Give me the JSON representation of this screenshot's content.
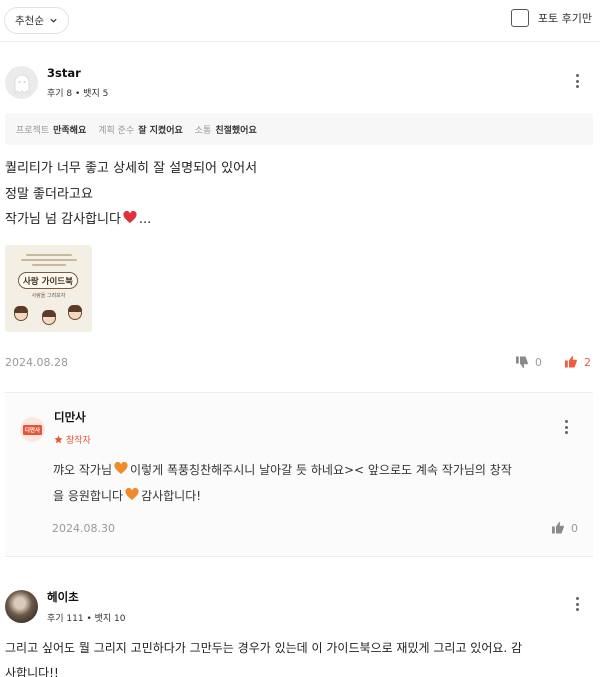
{
  "toolbar": {
    "sort_label": "추천순",
    "photo_filter_label": "포토 후기만"
  },
  "reviews": [
    {
      "author": "3star",
      "stats": "후기 8 • 뱃지 5",
      "ratings": [
        {
          "label": "프로젝트",
          "value": "만족해요"
        },
        {
          "label": "계획 준수",
          "value": "잘 지켰어요"
        },
        {
          "label": "소통",
          "value": "친절했어요"
        }
      ],
      "body": {
        "line1": "퀄리티가 너무 좋고 상세히 잘 설명되어 있어서",
        "line2": "정말 좋더라고요",
        "line3_before": "작가님 넘 감사합니다",
        "line3_after": "..."
      },
      "photo": {
        "title": "사랑 가이드북",
        "caption": "사랑을 그려보자"
      },
      "date": "2024.08.28",
      "dislikes": "0",
      "likes": "2",
      "reply": {
        "author": "디만사",
        "logo_text": "디만사",
        "badge": "창작자",
        "line1_a": "꺄오 작가님",
        "line1_b": "이렇게 폭풍칭찬해주시니 날아갈 듯 하네요>< 앞으로도 계속 작가님의 창작",
        "line2_a": "을 응원합니다",
        "line2_b": "감사합니다!",
        "date": "2024.08.30",
        "likes": "0"
      }
    },
    {
      "author": "헤이초",
      "stats": "후기 111 • 뱃지 10",
      "body": {
        "line1": "그리고 싶어도 뭘 그리지 고민하다가 그만두는 경우가 있는데 이 가이드북으로 재밌게 그리고 있어요. 감",
        "line2": "사합니다!!"
      }
    }
  ],
  "colors": {
    "accent": "#f25c3b",
    "creator": "#e8543a",
    "muted": "#9a9a9a",
    "heart_red": "#e0303a",
    "heart_orange": "#f08a2e"
  },
  "icons": {
    "sort_dropdown": "chevron-down-icon",
    "more": "more-vertical-icon",
    "dislike": "thumbs-down-icon",
    "like": "thumbs-up-icon",
    "creator": "star-icon",
    "heart": "heart-icon"
  }
}
